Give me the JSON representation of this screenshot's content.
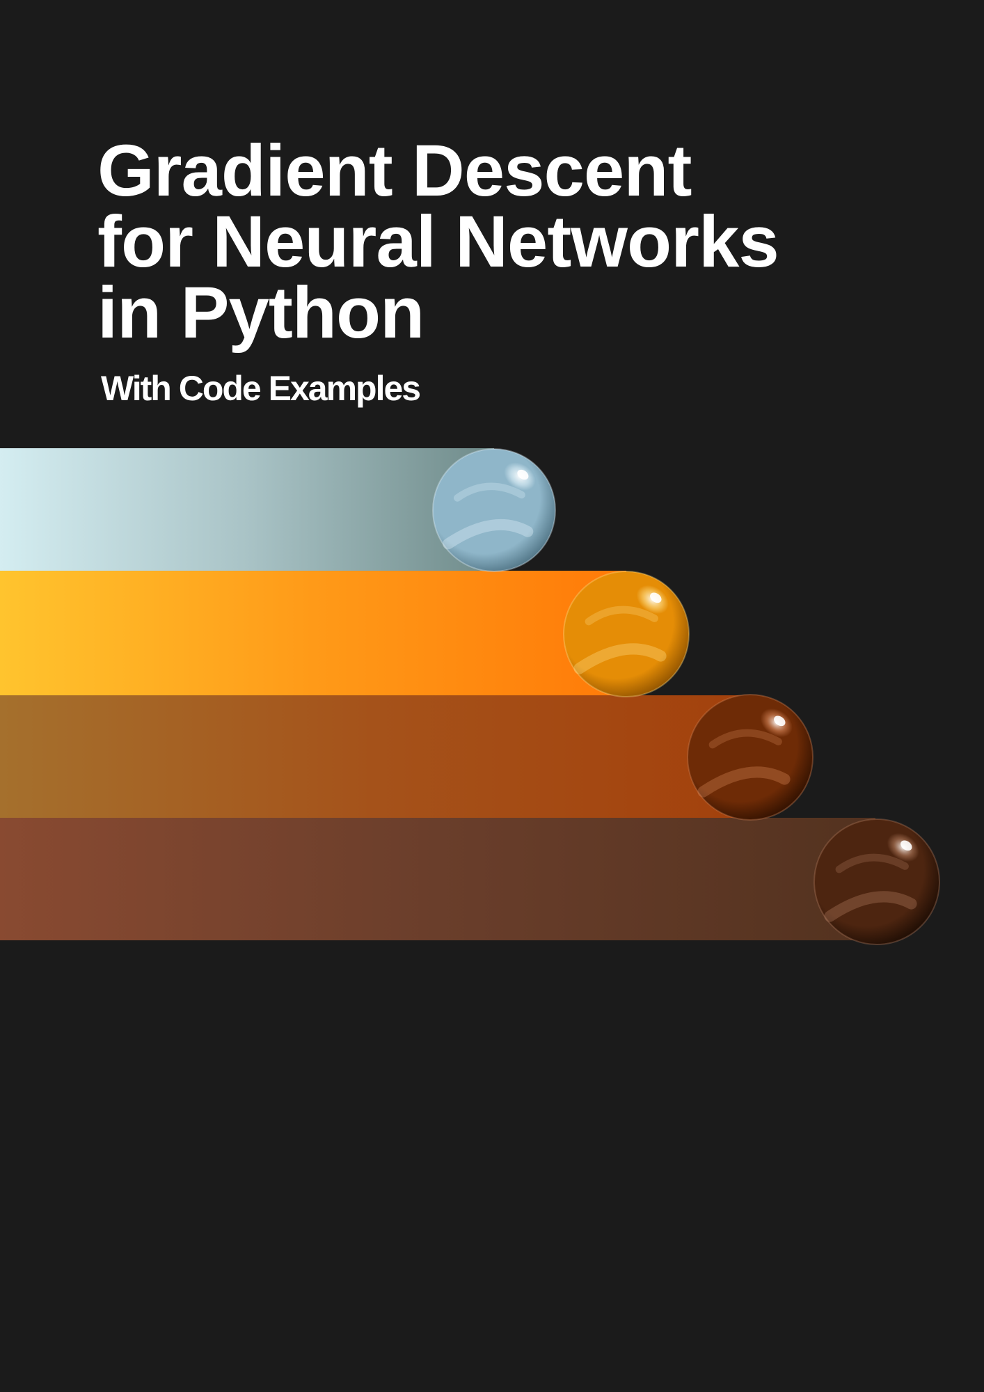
{
  "cover": {
    "title_lines": [
      "Gradient Descent",
      "for Neural Networks",
      "in Python"
    ],
    "subtitle": "With Code Examples",
    "background_color": "#1b1b1b",
    "text_color": "#ffffff"
  },
  "stripes": [
    {
      "name": "pale-blue",
      "gradient": [
        "#d4edf1",
        "#a9c3c6",
        "#6f8b8a"
      ],
      "sphere": {
        "base": "#8fb6c9",
        "highlight": "#e4f4fb",
        "shadow": "#4b6f80"
      }
    },
    {
      "name": "orange",
      "gradient": [
        "#ffc42e",
        "#ff9a18",
        "#ff7a08"
      ],
      "sphere": {
        "base": "#e58d06",
        "highlight": "#ffe08a",
        "shadow": "#8a4f00"
      }
    },
    {
      "name": "rust",
      "gradient": [
        "#a5702d",
        "#a5521a",
        "#a3410c"
      ],
      "sphere": {
        "base": "#6e2b06",
        "highlight": "#d8875a",
        "shadow": "#2c0f00"
      }
    },
    {
      "name": "brown",
      "gradient": [
        "#894a31",
        "#6a3e2b",
        "#53321f"
      ],
      "sphere": {
        "base": "#4d2510",
        "highlight": "#b47e60",
        "shadow": "#1a0b03"
      }
    }
  ]
}
